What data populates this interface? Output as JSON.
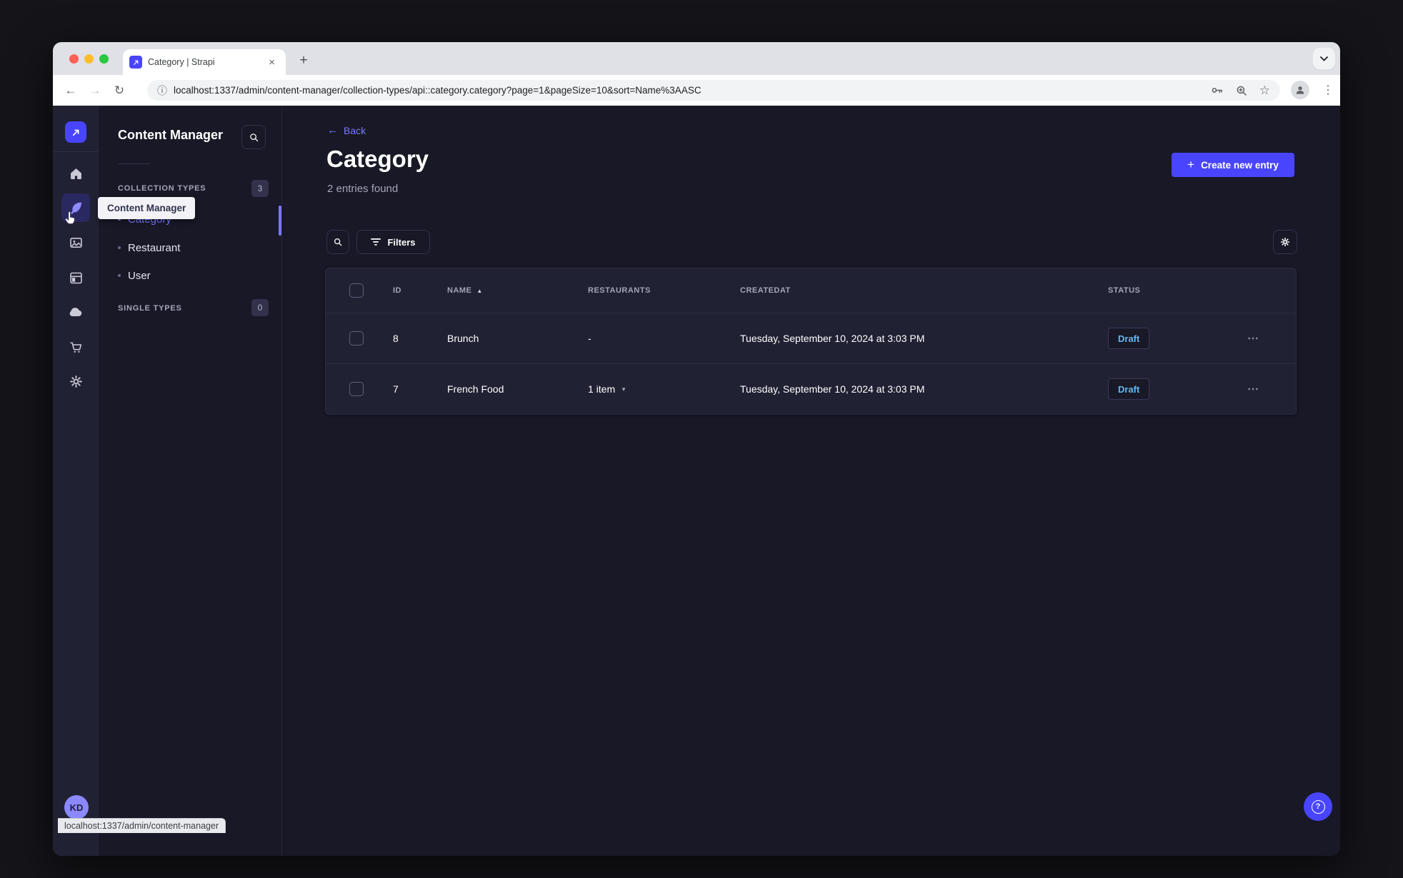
{
  "colors": {
    "accent": "#4945ff",
    "accent_light": "#7b79ff",
    "draft_text": "#66b7f1",
    "app_bg": "#181826",
    "card_bg": "#212134"
  },
  "glyphs": {
    "close": "×",
    "plus": "+",
    "back_arrow": "←",
    "forward_arrow": "→",
    "reload": "↻",
    "star": "☆",
    "info": "ⓘ",
    "menu_dots": "⋮",
    "sort_asc": "▲",
    "caret_down": "▼",
    "ellipsis": "⋯",
    "question": "?"
  },
  "browser": {
    "tab_title": "Category | Strapi",
    "url": "localhost:1337/admin/content-manager/collection-types/api::category.category?page=1&pageSize=10&sort=Name%3AASC",
    "status_link": "localhost:1337/admin/content-manager"
  },
  "sidebar": {
    "tooltip": "Content Manager",
    "avatar_initials": "KD",
    "icons": [
      "strapi-logo",
      "home",
      "content-manager",
      "media-library",
      "content-type-builder",
      "deploy",
      "marketplace",
      "settings"
    ]
  },
  "subnav": {
    "title": "Content Manager",
    "collection_types": {
      "label": "COLLECTION TYPES",
      "count": "3",
      "items": [
        "Category",
        "Restaurant",
        "User"
      ],
      "active_item": "Category"
    },
    "single_types": {
      "label": "SINGLE TYPES",
      "count": "0"
    }
  },
  "content": {
    "back": "Back",
    "title": "Category",
    "subtitle": "2 entries found",
    "create_button": "Create new entry",
    "filters_button": "Filters",
    "table": {
      "headers": {
        "id": "ID",
        "name": "NAME",
        "restaurants": "RESTAURANTS",
        "createdat": "CREATEDAT",
        "status": "STATUS"
      },
      "rows": [
        {
          "id": "8",
          "name": "Brunch",
          "restaurants": "-",
          "createdat": "Tuesday, September 10, 2024 at 3:03 PM",
          "status": "Draft"
        },
        {
          "id": "7",
          "name": "French Food",
          "restaurants": "1 item",
          "createdat": "Tuesday, September 10, 2024 at 3:03 PM",
          "status": "Draft"
        }
      ]
    }
  }
}
